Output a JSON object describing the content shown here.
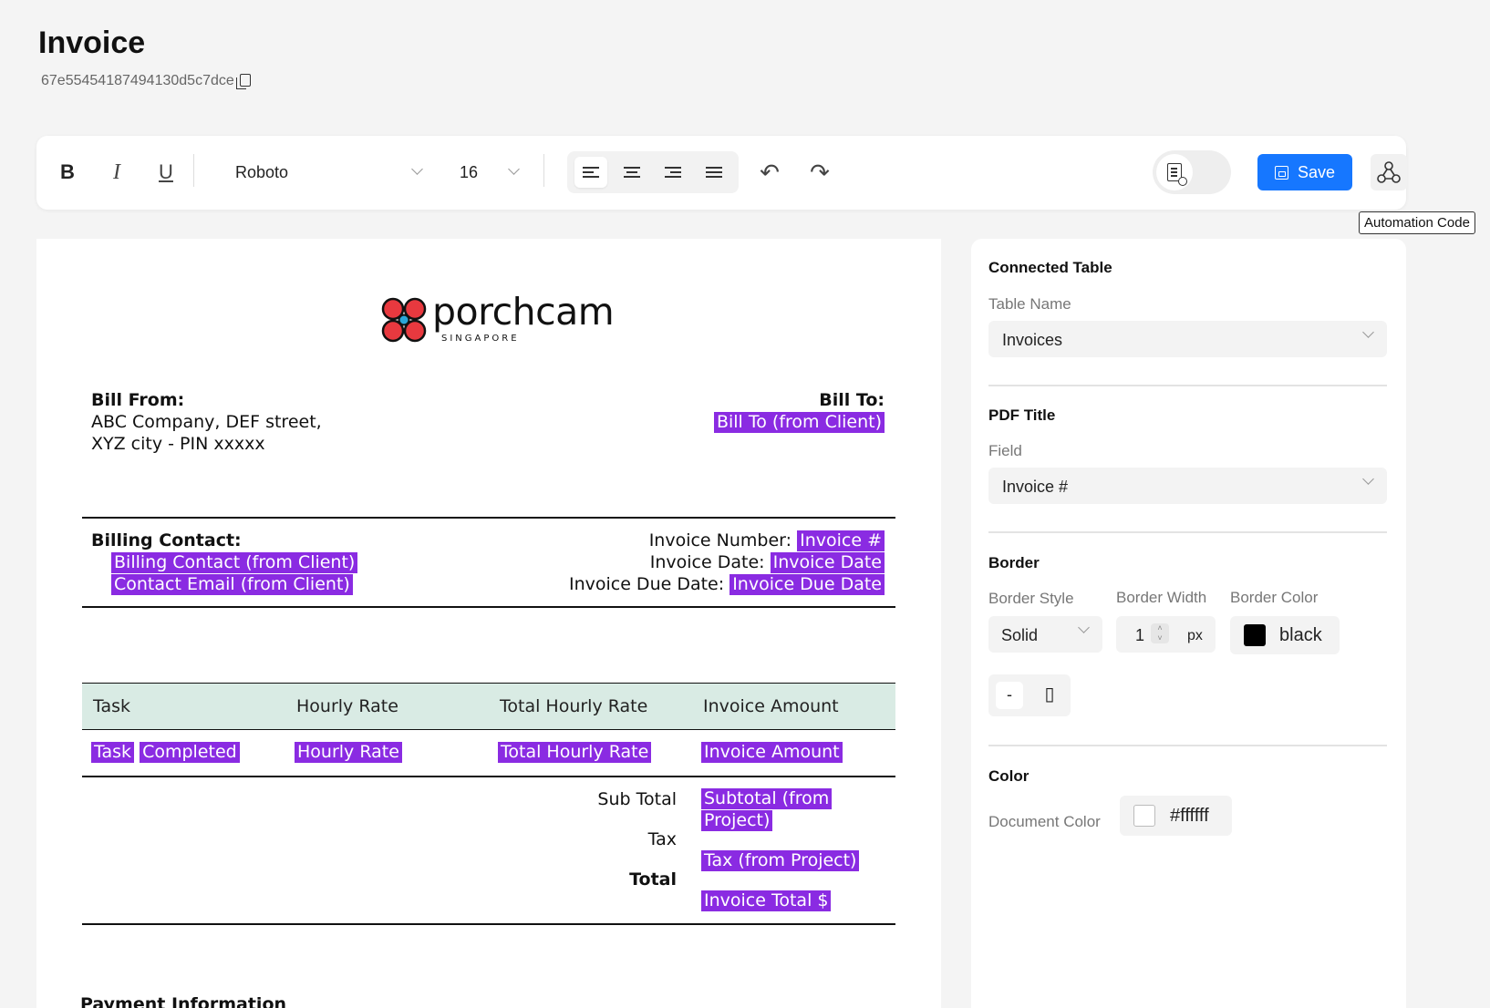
{
  "page": {
    "title": "Invoice",
    "doc_id": "67e55454187494130d5c7dce"
  },
  "toolbar": {
    "bold": "B",
    "italic": "I",
    "underline": "U",
    "font": "Roboto",
    "font_size": "16",
    "undo": "↶",
    "redo": "↷",
    "save_label": "Save",
    "automation_tooltip": "Automation Code"
  },
  "document": {
    "logo": {
      "name": "porchcam",
      "sub": "SINGAPORE",
      "accent": "#e8393f"
    },
    "bill_from": {
      "label": "Bill From:",
      "line1": "ABC Company, DEF street,",
      "line2": "XYZ city - PIN xxxxx"
    },
    "bill_to": {
      "label": "Bill To:",
      "value": "Bill To (from Client)"
    },
    "billing_contact": {
      "label": "Billing Contact:",
      "contact": "Billing Contact (from Client)",
      "email": "Contact Email (from Client)"
    },
    "invoice_meta": {
      "number_label": "Invoice Number:",
      "number_value": "Invoice #",
      "date_label": "Invoice Date:",
      "date_value": "Invoice Date",
      "due_label": "Invoice Due Date:",
      "due_value": "Invoice Due Date"
    },
    "table": {
      "headers": [
        "Task",
        "Hourly Rate",
        "Total Hourly Rate",
        "Invoice Amount"
      ],
      "row": {
        "task_a": "Task",
        "task_b": "Completed",
        "rate": "Hourly Rate",
        "total_rate": "Total Hourly Rate",
        "amount": "Invoice Amount"
      }
    },
    "totals": {
      "sub_label": "Sub Total",
      "sub_value_1": "Subtotal (from",
      "sub_value_2": "Project)",
      "tax_label": "Tax",
      "tax_value": "Tax (from Project)",
      "total_label": "Total",
      "total_value": "Invoice Total $"
    },
    "next_section": "Payment Information"
  },
  "panel": {
    "connected_table": {
      "heading": "Connected Table",
      "label": "Table Name",
      "value": "Invoices"
    },
    "pdf_title": {
      "heading": "PDF Title",
      "label": "Field",
      "value": "Invoice #"
    },
    "border": {
      "heading": "Border",
      "style_label": "Border Style",
      "style_value": "Solid",
      "width_label": "Border Width",
      "width_value": "1",
      "width_unit": "px",
      "color_label": "Border Color",
      "color_value": "black",
      "side_minus": "-",
      "side_box": "▯"
    },
    "color": {
      "heading": "Color",
      "label": "Document Color",
      "value": "#ffffff"
    }
  },
  "colors": {
    "placeholder": "#8a2be2",
    "primary": "#1677ff",
    "table_header": "#d9ebe4"
  }
}
